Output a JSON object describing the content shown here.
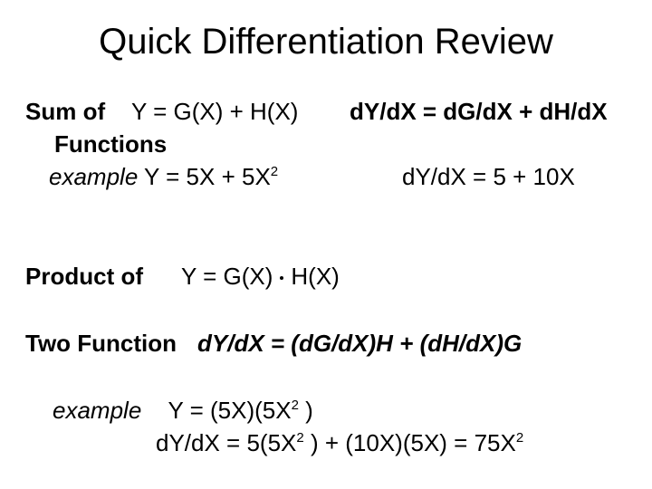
{
  "title": "Quick Differentiation Review",
  "sum_rule": {
    "label_line1": "Sum of",
    "label_line2": "Functions",
    "equation": "Y = G(X) + H(X)",
    "derivative": "dY/dX = dG/dX + dH/dX",
    "example_label": "example",
    "example_equation_base": "Y = 5X + 5X",
    "example_equation_exp": "2",
    "example_derivative": "dY/dX = 5 + 10X"
  },
  "product_rule": {
    "label_line1": "Product of",
    "label_line2": "Two Function",
    "equation_left": "Y = G(X)",
    "equation_right": "H(X)",
    "operator_icon": "multiplication-dot",
    "derivative": "dY/dX = (dG/dX)H + (dH/dX)G",
    "example_label": "example",
    "example_equation_a": "Y = (5X)(5X",
    "example_equation_exp": "2",
    "example_equation_b": " )",
    "example_derivative_a": "dY/dX = 5(5X",
    "example_derivative_exp1": "2",
    "example_derivative_b": " ) + (10X)(5X) = 75X",
    "example_derivative_exp2": "2"
  }
}
